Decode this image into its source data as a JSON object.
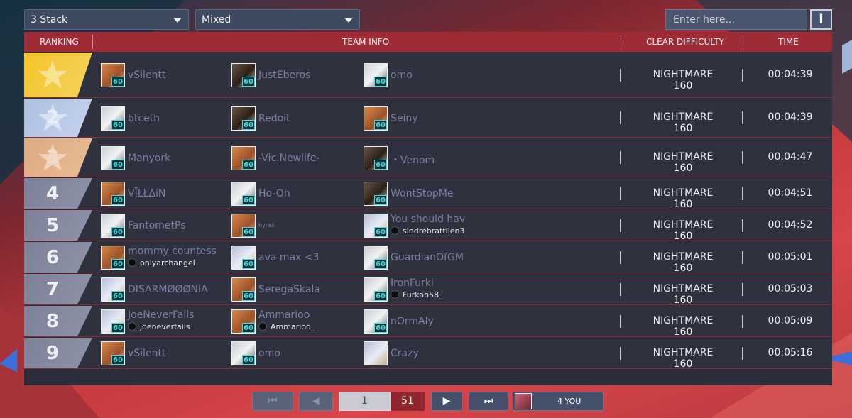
{
  "filters": {
    "stack": "3 Stack",
    "mode": "Mixed",
    "search_placeholder": "Enter here...",
    "info_label": "i"
  },
  "headers": {
    "ranking": "RANKING",
    "team_info": "TEAM INFO",
    "clear_difficulty": "CLEAR DIFFICULTY",
    "time": "TIME"
  },
  "rows": [
    {
      "rank": "1",
      "clear": "NIGHTMARE 160",
      "time": "00:04:39",
      "players": [
        {
          "name": "vSilentt",
          "sub": "",
          "level": "60",
          "avatar": "a"
        },
        {
          "name": "JustEberos",
          "sub": "",
          "level": "60",
          "avatar": "c"
        },
        {
          "name": "omo",
          "sub": "",
          "level": "60",
          "avatar": "b"
        }
      ]
    },
    {
      "rank": "2",
      "clear": "NIGHTMARE 160",
      "time": "00:04:39",
      "players": [
        {
          "name": "btceth",
          "sub": "",
          "level": "60",
          "avatar": "b"
        },
        {
          "name": "Redoit",
          "sub": "",
          "level": "60",
          "avatar": "c"
        },
        {
          "name": "Seiny",
          "sub": "",
          "level": "60",
          "avatar": "a"
        }
      ]
    },
    {
      "rank": "3",
      "clear": "NIGHTMARE 160",
      "time": "00:04:47",
      "players": [
        {
          "name": "Manyork",
          "sub": "",
          "level": "60",
          "avatar": "b"
        },
        {
          "name": "-Vic.Newlife-",
          "sub": "",
          "level": "60",
          "avatar": "a"
        },
        {
          "name": "・Venom",
          "sub": "",
          "level": "60",
          "avatar": "c"
        }
      ]
    },
    {
      "rank": "4",
      "clear": "NIGHTMARE 160",
      "time": "00:04:51",
      "players": [
        {
          "name": "VÏŁŁΔiN",
          "sub": "",
          "level": "60",
          "avatar": "a"
        },
        {
          "name": "Ho-Oh",
          "sub": "",
          "level": "60",
          "avatar": "b"
        },
        {
          "name": "WontStopMe",
          "sub": "",
          "level": "60",
          "avatar": "c"
        }
      ]
    },
    {
      "rank": "5",
      "clear": "NIGHTMARE 160",
      "time": "00:04:52",
      "players": [
        {
          "name": "FantometPs",
          "sub": "",
          "level": "60",
          "avatar": "b"
        },
        {
          "name": "hyrax",
          "sub": "",
          "level": "60",
          "avatar": "a"
        },
        {
          "name": "You should hav",
          "sub": "sindrebrattlien3",
          "level": "60",
          "avatar": "d"
        }
      ]
    },
    {
      "rank": "6",
      "clear": "NIGHTMARE 160",
      "time": "00:05:01",
      "players": [
        {
          "name": "mommy countess",
          "sub": "onlyarchangel",
          "level": "60",
          "avatar": "a"
        },
        {
          "name": "ava max <3",
          "sub": "",
          "level": "60",
          "avatar": "d"
        },
        {
          "name": "GuardianOfGM",
          "sub": "",
          "level": "60",
          "avatar": "b"
        }
      ]
    },
    {
      "rank": "7",
      "clear": "NIGHTMARE 160",
      "time": "00:05:03",
      "players": [
        {
          "name": "DISARMØØØNIA",
          "sub": "",
          "level": "60",
          "avatar": "d"
        },
        {
          "name": "SeregaSkala",
          "sub": "",
          "level": "60",
          "avatar": "a"
        },
        {
          "name": "IronFurki",
          "sub": "Furkan58_",
          "level": "60",
          "avatar": "b"
        }
      ]
    },
    {
      "rank": "8",
      "clear": "NIGHTMARE 160",
      "time": "00:05:09",
      "players": [
        {
          "name": "JoeNeverFails",
          "sub": "joeneverfails",
          "level": "60",
          "avatar": "d"
        },
        {
          "name": "Ammarioo",
          "sub": "Ammarioo_",
          "level": "60",
          "avatar": "a"
        },
        {
          "name": "nOrmAly",
          "sub": "",
          "level": "60",
          "avatar": "b"
        }
      ]
    },
    {
      "rank": "9",
      "clear": "NIGHTMARE 160",
      "time": "00:05:16",
      "players": [
        {
          "name": "vSilentt",
          "sub": "",
          "level": "60",
          "avatar": "a"
        },
        {
          "name": "omo",
          "sub": "",
          "level": "60",
          "avatar": "b"
        },
        {
          "name": "Crazy",
          "sub": "",
          "level": "",
          "avatar": "d"
        }
      ]
    }
  ],
  "pagination": {
    "first_icon": "skip-to-first-icon",
    "prev_icon": "previous-page-icon",
    "next_icon": "next-page-icon",
    "last_icon": "skip-to-last-icon",
    "current_page": "1",
    "total_pages": "51",
    "my_rank_label": "4 YOU"
  }
}
